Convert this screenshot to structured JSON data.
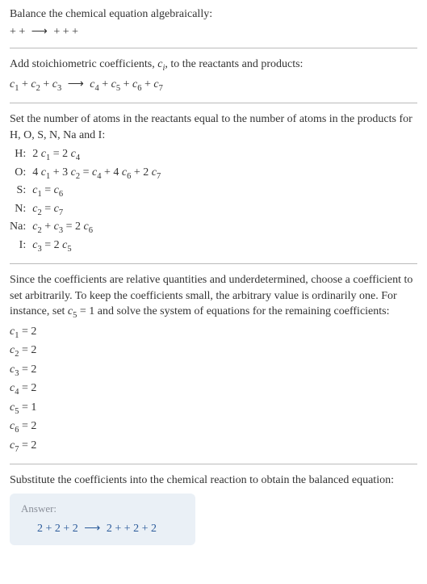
{
  "intro": {
    "line1": "Balance the chemical equation algebraically:",
    "reaction_lhs": " +  + ",
    "arrow": "⟶",
    "reaction_rhs": " +  +  + "
  },
  "step1": {
    "text": "Add stoichiometric coefficients, ",
    "ci": "c",
    "ci_sub": "i",
    "text2": ", to the reactants and products:",
    "eq_lhs_parts": [
      "c₁",
      " + ",
      "c₂",
      " + ",
      "c₃",
      " "
    ],
    "eq_rhs_parts": [
      " c₄",
      " + ",
      "c₅",
      " + ",
      "c₆",
      " + ",
      "c₇"
    ],
    "lhs": "c",
    "arrow": "⟶"
  },
  "atoms": {
    "intro": "Set the number of atoms in the reactants equal to the number of atoms in the products for H, O, S, N, Na and I:",
    "rows": [
      {
        "label": "H:",
        "eq": "2 c₁ = 2 c₄"
      },
      {
        "label": "O:",
        "eq": "4 c₁ + 3 c₂ = c₄ + 4 c₆ + 2 c₇"
      },
      {
        "label": "S:",
        "eq": "c₁ = c₆"
      },
      {
        "label": "N:",
        "eq": "c₂ = c₇"
      },
      {
        "label": "Na:",
        "eq": "c₂ + c₃ = 2 c₆"
      },
      {
        "label": "I:",
        "eq": "c₃ = 2 c₅"
      }
    ]
  },
  "underdet": {
    "text": "Since the coefficients are relative quantities and underdetermined, choose a coefficient to set arbitrarily. To keep the coefficients small, the arbitrary value is ordinarily one. For instance, set c₅ = 1 and solve the system of equations for the remaining coefficients:",
    "coeffs": [
      "c₁ = 2",
      "c₂ = 2",
      "c₃ = 2",
      "c₄ = 2",
      "c₅ = 1",
      "c₆ = 2",
      "c₇ = 2"
    ]
  },
  "substitute": {
    "text": "Substitute the coefficients into the chemical reaction to obtain the balanced equation:"
  },
  "answer": {
    "title": "Answer:",
    "lhs": "2  + 2  + 2 ",
    "arrow": "⟶",
    "rhs": " 2  +  + 2  + 2"
  }
}
